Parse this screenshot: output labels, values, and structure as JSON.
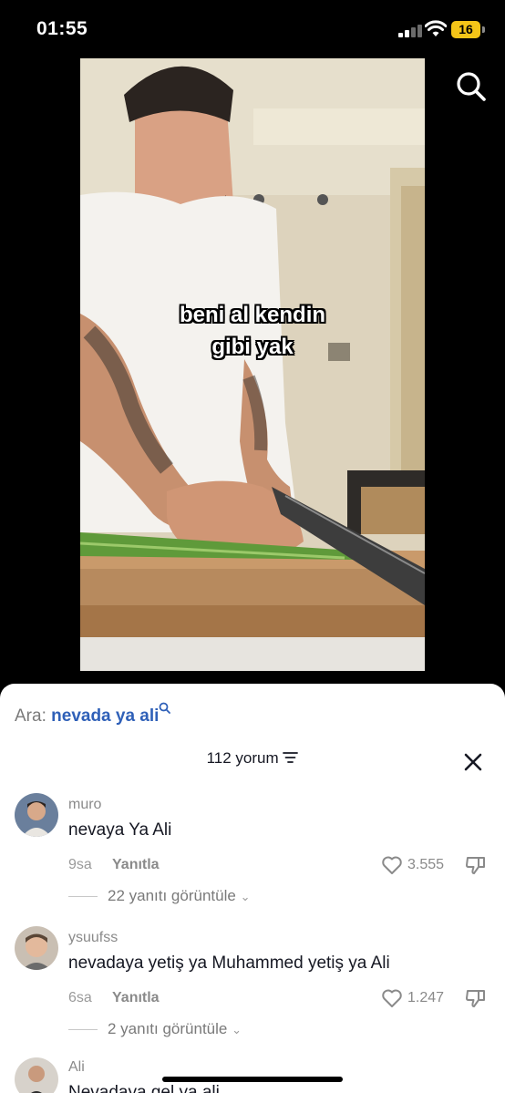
{
  "status": {
    "time": "01:55",
    "battery": "16"
  },
  "video": {
    "caption_line1": "beni al kendin",
    "caption_line2": "gibi yak"
  },
  "comments_panel": {
    "search_label": "Ara:",
    "search_query": "nevada ya ali",
    "count_label": "112 yorum",
    "comments": [
      {
        "username": "muro",
        "text": "nevaya Ya Ali",
        "time": "9sa",
        "reply_label": "Yanıtla",
        "likes": "3.555",
        "replies_label": "22 yanıtı görüntüle"
      },
      {
        "username": "ysuufss",
        "text": "nevadaya yetiş ya Muhammed yetiş ya Ali",
        "time": "6sa",
        "reply_label": "Yanıtla",
        "likes": "1.247",
        "replies_label": "2 yanıtı görüntüle"
      },
      {
        "username": "Ali",
        "text": "Nevadaya gel ya ali"
      }
    ]
  },
  "colors": {
    "accent_link": "#2f60b8",
    "battery": "#f5c518"
  }
}
